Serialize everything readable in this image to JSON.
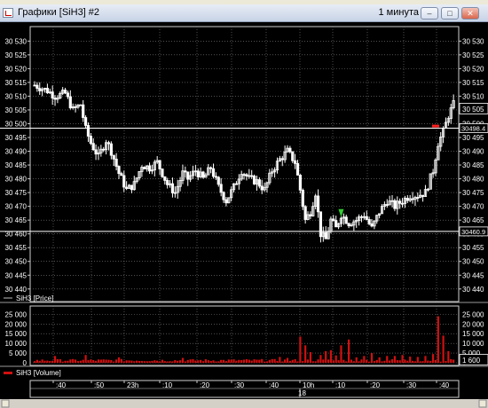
{
  "window": {
    "title": "Графики [SiH3] #2",
    "timeframe": "1 минута",
    "buttons": {
      "minimize": "–",
      "maximize": "□",
      "close": "✕"
    }
  },
  "colors": {
    "background": "#000000",
    "candle": "#ffffff",
    "volume": "#d01010",
    "grid": "#808080",
    "signal_buy": "#33cc33",
    "signal_sell": "#ff2020"
  },
  "chart_data": [
    {
      "type": "candlestick",
      "legend": "SiH3 [Price]",
      "ylim": [
        30438,
        30533
      ],
      "y_ticks": [
        30440,
        30445,
        30450,
        30455,
        30460,
        30465,
        30470,
        30475,
        30480,
        30485,
        30490,
        30495,
        30500,
        30505,
        30510,
        30515,
        30520,
        30525,
        30530
      ],
      "y_tick_labels": [
        "30 440",
        "30 445",
        "30 450",
        "30 455",
        "30 460",
        "30 465",
        "30 470",
        "30 475",
        "30 480",
        "30 485",
        "30 490",
        "30 495",
        "30 500",
        "30 505",
        "30 510",
        "30 515",
        "30 520",
        "30 525",
        "30 530"
      ],
      "level_lines": [
        {
          "price": 30498.4,
          "label": "30498.4"
        },
        {
          "price": 30460.9,
          "label": "30460.9"
        }
      ],
      "last_price_label": "30 505",
      "anchors": [
        [
          0,
          30514
        ],
        [
          5,
          30512
        ],
        [
          8,
          30510
        ],
        [
          12,
          30511
        ],
        [
          15,
          30505
        ],
        [
          18,
          30507
        ],
        [
          20,
          30498
        ],
        [
          22,
          30493
        ],
        [
          25,
          30488
        ],
        [
          28,
          30494
        ],
        [
          30,
          30490
        ],
        [
          33,
          30482
        ],
        [
          36,
          30476
        ],
        [
          39,
          30478
        ],
        [
          42,
          30485
        ],
        [
          45,
          30484
        ],
        [
          48,
          30486
        ],
        [
          52,
          30478
        ],
        [
          55,
          30475
        ],
        [
          58,
          30482
        ],
        [
          60,
          30480
        ],
        [
          63,
          30483
        ],
        [
          66,
          30480
        ],
        [
          69,
          30484
        ],
        [
          72,
          30477
        ],
        [
          75,
          30472
        ],
        [
          78,
          30477
        ],
        [
          81,
          30483
        ],
        [
          84,
          30480
        ],
        [
          87,
          30479
        ],
        [
          90,
          30476
        ],
        [
          93,
          30483
        ],
        [
          96,
          30487
        ],
        [
          99,
          30490
        ],
        [
          102,
          30486
        ],
        [
          104,
          30476
        ],
        [
          106,
          30465
        ],
        [
          108,
          30468
        ],
        [
          110,
          30475
        ],
        [
          112,
          30460
        ],
        [
          114,
          30458
        ],
        [
          116,
          30465
        ],
        [
          118,
          30462
        ],
        [
          120,
          30467
        ],
        [
          123,
          30464
        ],
        [
          126,
          30465
        ],
        [
          129,
          30467
        ],
        [
          132,
          30462
        ],
        [
          135,
          30468
        ],
        [
          138,
          30472
        ],
        [
          141,
          30470
        ],
        [
          144,
          30472
        ],
        [
          147,
          30474
        ],
        [
          150,
          30474
        ],
        [
          153,
          30475
        ],
        [
          156,
          30483
        ],
        [
          158,
          30493
        ],
        [
          160,
          30497
        ],
        [
          162,
          30503
        ],
        [
          164,
          30507
        ]
      ]
    },
    {
      "type": "bar",
      "legend": "SiH3 [Volume]",
      "ylim": [
        0,
        27000
      ],
      "y_ticks": [
        0,
        5000,
        10000,
        15000,
        20000,
        25000
      ],
      "y_tick_labels": [
        "0",
        "5 000",
        "10 000",
        "15 000",
        "20 000",
        "25 000"
      ],
      "last_value_label": "1 600",
      "spikes": [
        [
          8,
          3500
        ],
        [
          20,
          4000
        ],
        [
          33,
          2800
        ],
        [
          58,
          2500
        ],
        [
          96,
          3000
        ],
        [
          99,
          2500
        ],
        [
          104,
          13500
        ],
        [
          106,
          9000
        ],
        [
          108,
          5500
        ],
        [
          112,
          4000
        ],
        [
          114,
          6000
        ],
        [
          116,
          6500
        ],
        [
          118,
          3800
        ],
        [
          120,
          9000
        ],
        [
          123,
          12000
        ],
        [
          126,
          2800
        ],
        [
          129,
          3500
        ],
        [
          132,
          5000
        ],
        [
          135,
          2800
        ],
        [
          138,
          3500
        ],
        [
          141,
          3500
        ],
        [
          144,
          4000
        ],
        [
          147,
          3200
        ],
        [
          150,
          3000
        ],
        [
          153,
          3500
        ],
        [
          156,
          4500
        ],
        [
          158,
          24000
        ],
        [
          160,
          14000
        ],
        [
          162,
          6000
        ],
        [
          164,
          1600
        ]
      ],
      "base_volume": 1500
    }
  ],
  "time_axis": {
    "labels": [
      ":40",
      ":50",
      "23h",
      ":10",
      ":20",
      ":30",
      ":40",
      "10h",
      ":10",
      ":20",
      ":30",
      ":40"
    ],
    "date_label": "18"
  }
}
